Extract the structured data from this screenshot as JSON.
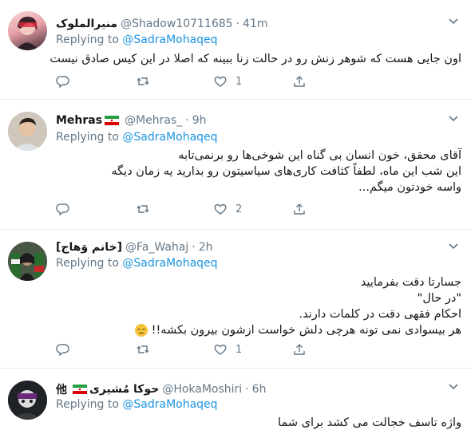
{
  "tweets": [
    {
      "name": "منيرالملوک",
      "handle": "@Shadow10711685",
      "time": "41m",
      "replying_label": "Replying to",
      "replying_to": "@SadraMohaqeq",
      "lines": [
        "اون جایی هست که شوهر زنش رو در حالت زنا ببینه که اصلا در این کیس صادق نیست"
      ],
      "likes": "1",
      "retweets": "",
      "replies": ""
    },
    {
      "name": "Mehras",
      "handle": "@Mehras_",
      "time": "9h",
      "replying_label": "Replying to",
      "replying_to": "@SadraMohaqeq",
      "lines": [
        "آقای محقق، خون انسان بی گناه این شوخی‌ها رو برنمی‌تابه",
        "این شب این ماه، لطفاً کثافت کاری‌های سیاسیتون رو بذارید یه زمان دیگه",
        "واسه خودتون میگم..."
      ],
      "likes": "2",
      "retweets": "",
      "replies": ""
    },
    {
      "name": "[خانم وَهاج]",
      "handle": "@Fa_Wahaj",
      "time": "2h",
      "replying_label": "Replying to",
      "replying_to": "@SadraMohaqeq",
      "lines": [
        "جسارتا دقت بفرمایید",
        "\"در حال\"",
        "احکام فقهی دقت در کلمات دارند.",
        "هر بیسوادی نمی تونه هرچی دلش خواست ازشون بیرون بکشه!!"
      ],
      "likes": "1",
      "retweets": "",
      "replies": ""
    },
    {
      "name": "حوکا مُشیری",
      "name_suffix": "他",
      "handle": "@HokaMoshiri",
      "time": "6h",
      "replying_label": "Replying to",
      "replying_to": "@SadraMohaqeq",
      "lines": [
        "واژه تاسف خجالت می کشد برای شما"
      ],
      "likes": "",
      "retweets": "",
      "replies": ""
    }
  ],
  "dot": "·",
  "colors": {
    "link": "#1b95e0",
    "muted": "#657786",
    "divider": "#e6ecf0"
  }
}
